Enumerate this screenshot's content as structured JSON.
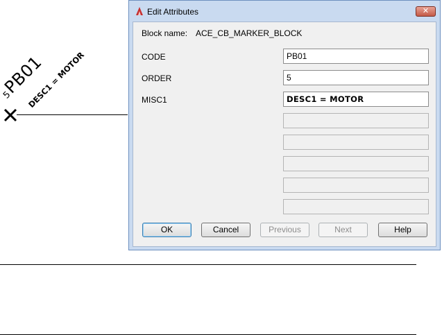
{
  "drawing": {
    "order_text": "5",
    "code_text": "PB01",
    "desc_text": "DESC1 = MOTOR",
    "marker_icon": "x-marker-icon"
  },
  "dialog": {
    "title": "Edit Attributes",
    "app_icon": "autocad-icon",
    "close_icon": "close-icon",
    "block_name_label": "Block name:",
    "block_name_value": "ACE_CB_MARKER_BLOCK",
    "attributes": {
      "code_label": "CODE",
      "code_value": "PB01",
      "order_label": "ORDER",
      "order_value": "5",
      "misc1_label": "MISC1",
      "misc1_value": "DESC1 = MOTOR"
    },
    "buttons": {
      "ok": "OK",
      "cancel": "Cancel",
      "previous": "Previous",
      "next": "Next",
      "help": "Help"
    }
  }
}
